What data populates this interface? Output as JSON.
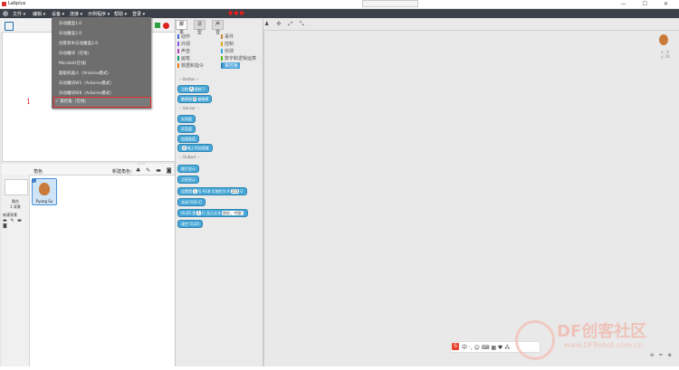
{
  "window": {
    "title": "Labplus"
  },
  "menu": {
    "items": [
      {
        "label": "文件 ▾"
      },
      {
        "label": "编辑 ▾"
      },
      {
        "label": "设备 ▾"
      },
      {
        "label": "连接 ▾"
      },
      {
        "label": "示例程序 ▾"
      },
      {
        "label": "帮助 ▾"
      },
      {
        "label": "登录 ▾"
      }
    ]
  },
  "device_menu": {
    "items": [
      {
        "label": "乐动魔盒1.0"
      },
      {
        "label": "乐动魔盒2.0"
      },
      {
        "label": "创客积木乐动魔盒2.0"
      },
      {
        "label": "乐动魔块（在线）"
      },
      {
        "label": "Microbit(在线)"
      },
      {
        "label": "超级机器人（Arduino模式）"
      },
      {
        "label": "乐动魔块W1（Arduino模式）"
      },
      {
        "label": "乐动魔块W8（Arduino模式）"
      },
      {
        "label": "✓ 掌控板（在线）"
      }
    ]
  },
  "stage": {
    "marker": "1"
  },
  "sprite_panel": {
    "header_label": "角色",
    "new_sprite_label": "新建角色：",
    "stage_label": "舞台\n1 背景",
    "new_backdrop_label": "新建背景",
    "sprite_name": "Pyong Su"
  },
  "palette": {
    "tabs": [
      {
        "label": "脚本"
      },
      {
        "label": "造型"
      },
      {
        "label": "声音"
      }
    ],
    "categories_left": [
      {
        "label": "动作",
        "color": "#4a6cd4"
      },
      {
        "label": "外观",
        "color": "#8a55d7"
      },
      {
        "label": "声音",
        "color": "#bb42c3"
      },
      {
        "label": "画笔",
        "color": "#0e9a6c"
      },
      {
        "label": "数据和指令",
        "color": "#ee7d16"
      }
    ],
    "categories_right": [
      {
        "label": "事件",
        "color": "#c88330"
      },
      {
        "label": "控制",
        "color": "#e1a91a"
      },
      {
        "label": "侦测",
        "color": "#2ca5e2"
      },
      {
        "label": "数字和逻辑运算",
        "color": "#5cb712"
      },
      {
        "label": "掌控板",
        "color": "#4aa3d9"
      }
    ],
    "sections": {
      "button": "-- Button --",
      "sensor": "-- Sensor --",
      "output": "-- Output --"
    },
    "blocks": {
      "b1_prefix": "当按",
      "b1_slot": "A",
      "b1_suffix": "键按下",
      "b2_prefix": "触摸键",
      "b2_slot": "P",
      "b2_suffix": "被触摸",
      "s1": "光线值",
      "s2": "声音值",
      "s3": "加速度值",
      "s4_prefix": "X",
      "s4_suffix": "轴上的加速度",
      "o1": "熄灭显示",
      "o2": "点亮显示",
      "o3_prefix": "设置第",
      "o3_slot": "1",
      "o3_mid": "号 RGB 灯颜色为 R",
      "o3_slot2": "255",
      "o3_tail": "G",
      "o4": "关闭 RGB 灯",
      "o5_prefix": "OLED 第",
      "o5_slot": "1",
      "o5_mid": "行 显示文本",
      "o5_slot2": "你好，中国!",
      "o6": "清空 OLED"
    }
  },
  "script_area": {
    "coords": "x: -4\ny: 20",
    "ime_text": "中 ·, ☺ ⌨ ▦ ♥ ⁂"
  },
  "watermark": {
    "brand": "DF创客社区",
    "url": "www.DFRobot.com.cn"
  }
}
